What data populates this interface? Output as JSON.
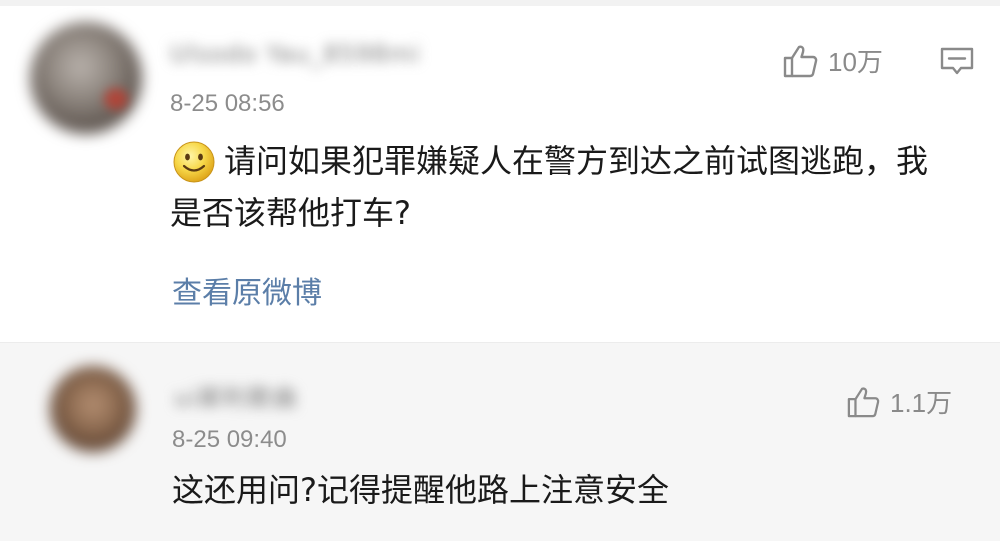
{
  "comments": [
    {
      "username": "Ulsodo Yau_8598mi",
      "timestamp": "8-25 08:56",
      "text": "请问如果犯罪嫌疑人在警方到达之前试图逃跑，我是否该帮他打车?",
      "like_count": "10万",
      "view_original_label": "查看原微博",
      "emoji_icon": "smiley-emoji-icon",
      "like_icon": "thumbs-up-icon",
      "reply_icon": "comment-icon"
    },
    {
      "username": "ui犀利歌曲",
      "timestamp": "8-25 09:40",
      "text": "这还用问?记得提醒他路上注意安全",
      "like_count": "1.1万",
      "like_icon": "thumbs-up-icon"
    }
  ],
  "colors": {
    "link": "#5b7ea8",
    "body_text": "#1a1a1a",
    "meta_text": "#8c8c8c",
    "reply_background": "#f6f6f6"
  }
}
